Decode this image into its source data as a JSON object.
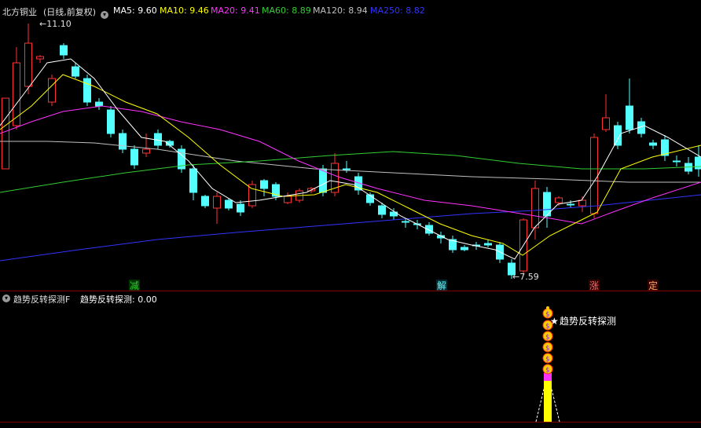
{
  "header": {
    "stock_name": "北方铜业",
    "period": "(日线,前复权)",
    "ma": [
      {
        "label": "MA5: 9.60",
        "color": "#ffffff"
      },
      {
        "label": "MA10: 9.46",
        "color": "#ffff00"
      },
      {
        "label": "MA20: 9.41",
        "color": "#ff33ff"
      },
      {
        "label": "MA60: 8.89",
        "color": "#33cc33"
      },
      {
        "label": "MA120: 8.94",
        "color": "#c0c0c0"
      },
      {
        "label": "MA250: 8.82",
        "color": "#3333ff"
      }
    ]
  },
  "price_panel": {
    "high_label": "11.10",
    "low_label": "7.59",
    "signals": [
      {
        "text": "减",
        "color": "#33cc33",
        "bg": "#003300"
      },
      {
        "text": "解",
        "color": "#66ffff",
        "bg": "#002a33"
      },
      {
        "text": "涨",
        "color": "#ff6666",
        "bg": "#330000"
      },
      {
        "text": "定",
        "color": "#ffaa66",
        "bg": "#330000"
      }
    ]
  },
  "indicator_panel": {
    "title": "趋势反转探测F",
    "value_label": "趋势反转探测: 0.00",
    "annotation": "趋势反转探测",
    "coin_symbol": "$"
  },
  "colors": {
    "up": "#ff3333",
    "down": "#54ffff",
    "grid": "#800000",
    "ma5": "#ffffff",
    "ma10": "#ffff00",
    "ma20": "#ff33ff",
    "ma60": "#33cc33",
    "ma120": "#c0c0c0",
    "ma250": "#3333ff"
  }
}
